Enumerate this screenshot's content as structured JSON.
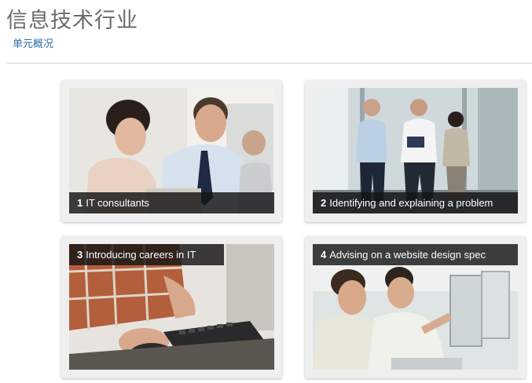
{
  "page": {
    "title": "信息技术行业",
    "subtitle_link": "单元概况"
  },
  "cards": [
    {
      "number": "1",
      "title": "IT consultants"
    },
    {
      "number": "2",
      "title": "Identifying and explaining a problem"
    },
    {
      "number": "3",
      "title": "Introducing careers in IT"
    },
    {
      "number": "4",
      "title": "Advising on a website design spec"
    }
  ]
}
